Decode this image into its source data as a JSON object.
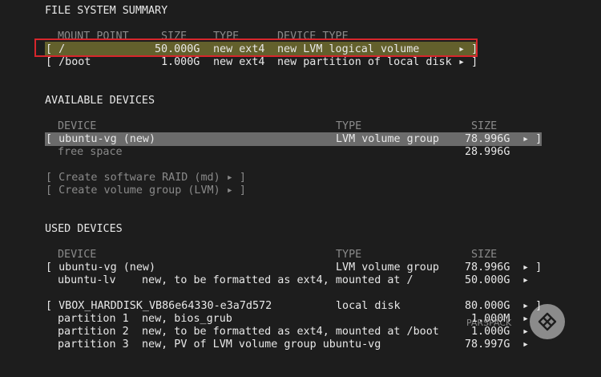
{
  "fs_summary": {
    "title": "FILE SYSTEM SUMMARY",
    "columns": [
      "MOUNT POINT",
      "SIZE",
      "TYPE",
      "DEVICE TYPE"
    ],
    "rows": [
      {
        "mount": "[ /",
        "size": "50.000G",
        "type": "new ext4",
        "device_type": "new LVM logical volume",
        "arrow": "▸ ]"
      },
      {
        "mount": "[ /boot",
        "size": "1.000G",
        "type": "new ext4",
        "device_type": "new partition of local disk",
        "arrow": "▸ ]"
      }
    ]
  },
  "available_devices": {
    "title": "AVAILABLE DEVICES",
    "columns": [
      "DEVICE",
      "TYPE",
      "SIZE"
    ],
    "rows": [
      {
        "device": "[ ubuntu-vg (new)",
        "type": "LVM volume group",
        "size": "78.996G",
        "arrow": "▸ ]"
      },
      {
        "device": "free space",
        "type": "",
        "size": "28.996G",
        "arrow": ""
      }
    ],
    "actions": [
      "[ Create software RAID (md) ▸ ]",
      "[ Create volume group (LVM) ▸ ]"
    ]
  },
  "used_devices": {
    "title": "USED DEVICES",
    "columns": [
      "DEVICE",
      "TYPE",
      "SIZE"
    ],
    "group1": {
      "row": {
        "device": "[ ubuntu-vg (new)",
        "type": "LVM volume group",
        "size": "78.996G",
        "arrow": "▸ ]"
      },
      "lv": {
        "name": "ubuntu-lv",
        "desc": "new, to be formatted as ext4, mounted at /",
        "size": "50.000G",
        "arrow": "▸"
      }
    },
    "group2": {
      "row": {
        "device": "[ VBOX_HARDDISK_VB86e64330-e3a7d572",
        "type": "local disk",
        "size": "80.000G",
        "arrow": "▸ ]"
      },
      "partitions": [
        {
          "name": "partition 1",
          "desc": "new, bios_grub",
          "size": "1.000M",
          "arrow": "▸"
        },
        {
          "name": "partition 2",
          "desc": "new, to be formatted as ext4, mounted at /boot",
          "size": "1.000G",
          "arrow": "▸"
        },
        {
          "name": "partition 3",
          "desc": "new, PV of LVM volume group ubuntu-vg",
          "size": "78.997G",
          "arrow": "▸"
        }
      ]
    }
  },
  "watermark": {
    "text": "PARSPACK"
  }
}
